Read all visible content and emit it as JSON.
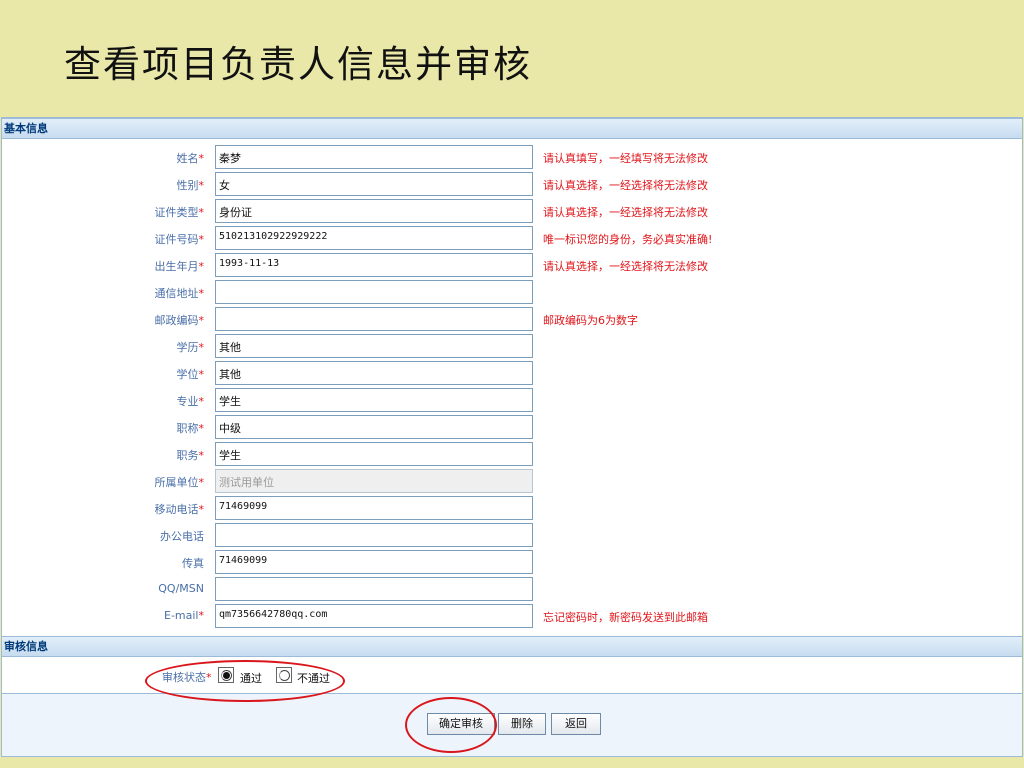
{
  "page": {
    "title": "查看项目负责人信息并审核"
  },
  "sections": {
    "basic": "基本信息",
    "audit": "审核信息"
  },
  "form": {
    "required_mark": "*",
    "fields": [
      {
        "label": "姓名",
        "required": true,
        "value": "秦梦",
        "hint": "请认真填写，一经填写将无法修改"
      },
      {
        "label": "性别",
        "required": true,
        "value": "女",
        "hint": "请认真选择，一经选择将无法修改"
      },
      {
        "label": "证件类型",
        "required": true,
        "value": "身份证",
        "hint": "请认真选择，一经选择将无法修改"
      },
      {
        "label": "证件号码",
        "required": true,
        "value": "510213102922929222",
        "hint": "唯一标识您的身份，务必真实准确!"
      },
      {
        "label": "出生年月",
        "required": true,
        "value": "1993-11-13",
        "hint": "请认真选择，一经选择将无法修改"
      },
      {
        "label": "通信地址",
        "required": true,
        "value": "",
        "hint": ""
      },
      {
        "label": "邮政编码",
        "required": true,
        "value": "",
        "hint": "邮政编码为6为数字"
      },
      {
        "label": "学历",
        "required": true,
        "value": "其他",
        "hint": ""
      },
      {
        "label": "学位",
        "required": true,
        "value": "其他",
        "hint": ""
      },
      {
        "label": "专业",
        "required": true,
        "value": "学生",
        "hint": ""
      },
      {
        "label": "职称",
        "required": true,
        "value": "中级",
        "hint": ""
      },
      {
        "label": "职务",
        "required": true,
        "value": "学生",
        "hint": ""
      },
      {
        "label": "所属单位",
        "required": true,
        "value": "测试用单位",
        "hint": ""
      },
      {
        "label": "移动电话",
        "required": true,
        "value": "71469099",
        "hint": ""
      },
      {
        "label": "办公电话",
        "required": false,
        "value": "",
        "hint": ""
      },
      {
        "label": "传真",
        "required": false,
        "value": "71469099",
        "hint": ""
      },
      {
        "label": "QQ/MSN",
        "required": false,
        "value": "",
        "hint": ""
      },
      {
        "label": "E-mail",
        "required": true,
        "value": "qm7356642780qq.com",
        "hint": "忘记密码时，新密码发送到此邮箱"
      }
    ]
  },
  "audit": {
    "label": "审核状态",
    "options": [
      {
        "label": "通过",
        "selected": true
      },
      {
        "label": "不通过",
        "selected": false
      }
    ]
  },
  "buttons": {
    "confirm": "确定审核",
    "delete": "删除",
    "back": "返回"
  },
  "colors": {
    "background": "#e9e8a9",
    "required": "#e0151a",
    "label": "#4a6fa8",
    "highlight": "#d9161c"
  }
}
